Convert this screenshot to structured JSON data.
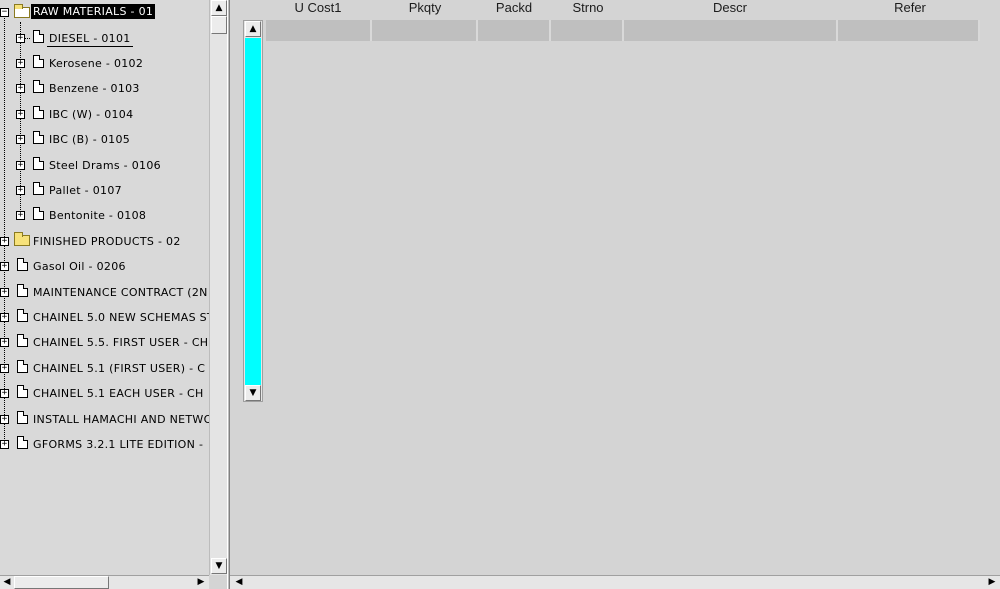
{
  "tree": {
    "root": {
      "label": "RAW MATERIALS - 01"
    },
    "children": [
      {
        "label": "DIESEL - 0101"
      },
      {
        "label": "Kerosene - 0102"
      },
      {
        "label": "Benzene - 0103"
      },
      {
        "label": "IBC (W) - 0104"
      },
      {
        "label": "IBC (B) - 0105"
      },
      {
        "label": "Steel Drams - 0106"
      },
      {
        "label": "Pallet - 0107"
      },
      {
        "label": "Bentonite - 0108"
      }
    ],
    "siblings": [
      {
        "label": "FINISHED PRODUCTS - 02",
        "icon": "folder-icon"
      },
      {
        "label": "Gasol Oil - 0206",
        "icon": "document-icon"
      },
      {
        "label": "MAINTENANCE CONTRACT (2N",
        "icon": "document-icon"
      },
      {
        "label": "CHAINEL 5.0 NEW SCHEMAS ST",
        "icon": "document-icon"
      },
      {
        "label": "CHAINEL 5.5. FIRST USER - CH",
        "icon": "document-icon"
      },
      {
        "label": "CHAINEL 5.1 (FIRST USER) - C",
        "icon": "document-icon"
      },
      {
        "label": "CHAINEL 5.1 EACH USER - CH",
        "icon": "document-icon"
      },
      {
        "label": "INSTALL HAMACHI AND NETWO",
        "icon": "document-icon"
      },
      {
        "label": "GFORMS 3.2.1 LITE EDITION -",
        "icon": "document-icon"
      }
    ]
  },
  "grid": {
    "columns": [
      "U Cost1",
      "Pkqty",
      "Packd",
      "Strno",
      "Descr",
      "Refer"
    ]
  },
  "glyphs": {
    "expand": "+",
    "collapse": "−",
    "arrow_up": "▲",
    "arrow_down": "▼",
    "arrow_left": "◀",
    "arrow_right": "▶"
  },
  "colors": {
    "selection_bg": "#000000",
    "scroll_thumb_accent": "#00ffff",
    "cell_bg": "#bfbfbf",
    "panel_bg": "#d4d4d4"
  }
}
